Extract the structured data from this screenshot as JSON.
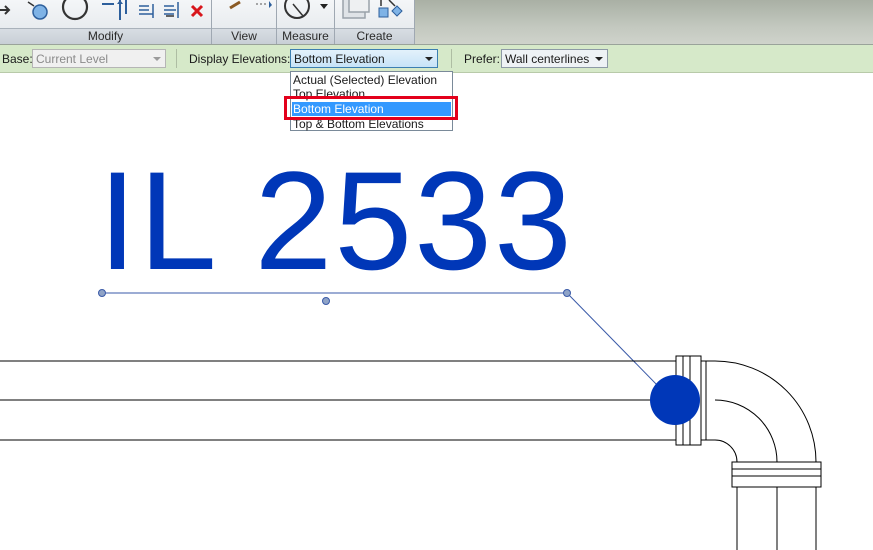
{
  "ribbon": {
    "panels": [
      {
        "label": "Modify"
      },
      {
        "label": "View"
      },
      {
        "label": "Measure"
      },
      {
        "label": "Create"
      }
    ]
  },
  "options_bar": {
    "base_label": "Base:",
    "base_value": "Current Level",
    "display_elevations_label": "Display Elevations:",
    "display_elevations_value": "Bottom Elevation",
    "prefer_label": "Prefer:",
    "prefer_value": "Wall centerlines"
  },
  "dropdown": {
    "options": [
      "Actual (Selected) Elevation",
      "Top Elevation",
      "Bottom Elevation",
      "Top & Bottom Elevations"
    ],
    "selected_index": 2
  },
  "canvas": {
    "tag_text": "IL 2533",
    "tag_color": "#0037b8"
  },
  "colors": {
    "accent": "#3399ff",
    "highlight": "#e3001b",
    "options_bar_bg": "#d6e9c9"
  }
}
